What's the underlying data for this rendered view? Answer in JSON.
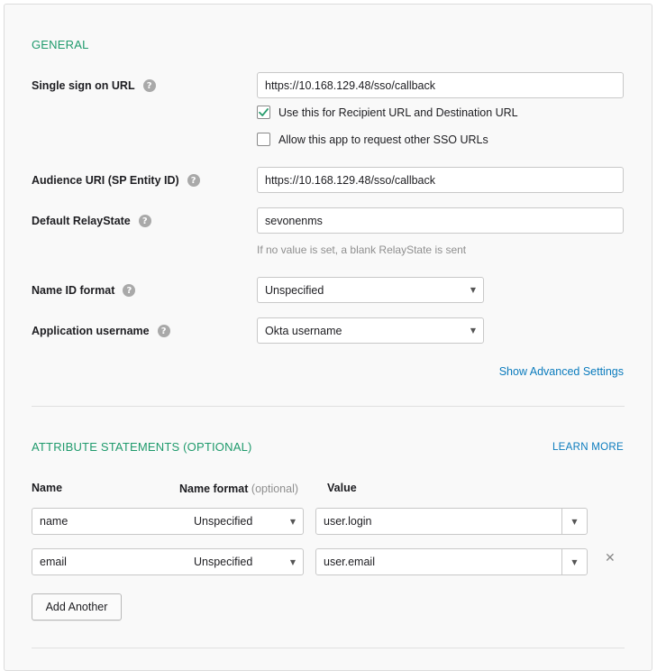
{
  "general": {
    "title": "GENERAL",
    "sso_url": {
      "label": "Single sign on URL",
      "value": "https://10.168.129.48/sso/callback",
      "recipient_checkbox": {
        "label": "Use this for Recipient URL and Destination URL",
        "checked": true
      },
      "other_sso_checkbox": {
        "label": "Allow this app to request other SSO URLs",
        "checked": false
      }
    },
    "audience_uri": {
      "label": "Audience URI (SP Entity ID)",
      "value": "https://10.168.129.48/sso/callback"
    },
    "relay_state": {
      "label": "Default RelayState",
      "value": "sevonenms",
      "hint": "If no value is set, a blank RelayState is sent"
    },
    "name_id_format": {
      "label": "Name ID format",
      "value": "Unspecified"
    },
    "app_username": {
      "label": "Application username",
      "value": "Okta username"
    },
    "advanced_link": "Show Advanced Settings"
  },
  "attributes": {
    "title": "ATTRIBUTE STATEMENTS (OPTIONAL)",
    "learn_more": "LEARN MORE",
    "columns": {
      "name": "Name",
      "format": "Name format",
      "format_optional": "(optional)",
      "value": "Value"
    },
    "rows": [
      {
        "name": "name",
        "format": "Unspecified",
        "value": "user.login"
      },
      {
        "name": "email",
        "format": "Unspecified",
        "value": "user.email"
      }
    ],
    "add_button": "Add Another"
  },
  "colors": {
    "section_title": "#1f9a6c",
    "link": "#0a7bbd",
    "check": "#2a9d6e"
  },
  "icons": {
    "help": "question-mark-icon",
    "checkmark": "checkmark-icon",
    "caret": "caret-down-icon",
    "remove": "close-icon"
  }
}
